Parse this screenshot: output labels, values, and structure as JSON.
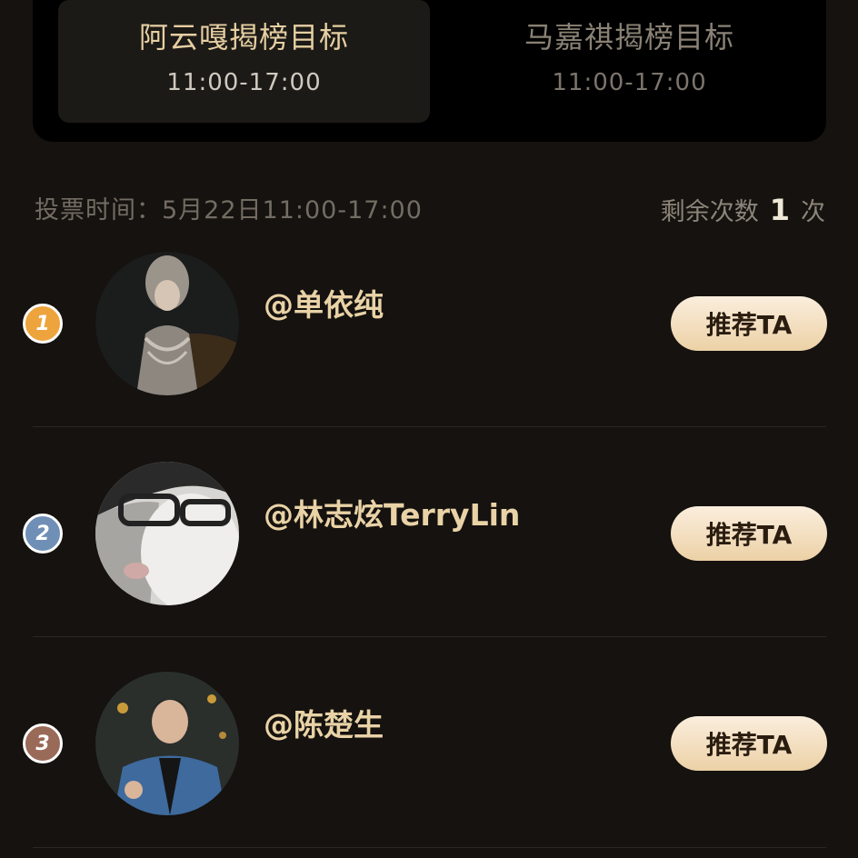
{
  "tabs": [
    {
      "title": "阿云嘎揭榜目标",
      "time": "11:00-17:00",
      "active": true
    },
    {
      "title": "马嘉祺揭榜目标",
      "time": "11:00-17:00",
      "active": false
    }
  ],
  "vote_info": {
    "label": "投票时间：5月22日11:00-17:00",
    "remaining_prefix": "剩余次数",
    "remaining_count": "1",
    "remaining_suffix": "次"
  },
  "candidates": [
    {
      "rank": "1",
      "name": "@单依纯",
      "button": "推荐TA"
    },
    {
      "rank": "2",
      "name": "@林志炫TerryLin",
      "button": "推荐TA"
    },
    {
      "rank": "3",
      "name": "@陈楚生",
      "button": "推荐TA"
    }
  ],
  "colors": {
    "background": "#15120f",
    "gold_text": "#e9d2a6",
    "rank1": "#eea43c",
    "rank2": "#6f8fb6",
    "rank3": "#9a6a58"
  }
}
